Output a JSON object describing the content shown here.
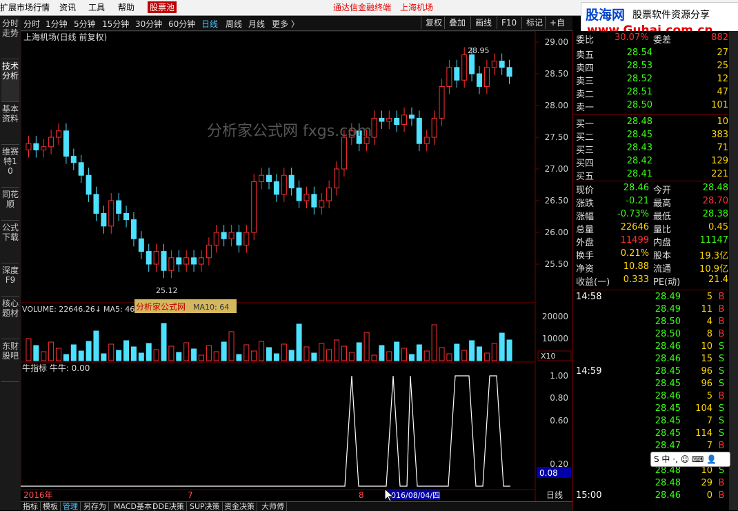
{
  "menu": {
    "items": [
      "扩展市场行情",
      "资讯",
      "工具",
      "帮助"
    ],
    "active": "股票池",
    "center_text": "通达信金融终端",
    "center_stock": "上海机场"
  },
  "left_tabs": [
    "分时走势",
    "技术分析",
    "基本资料",
    "维赛特10",
    "同花顺",
    "公式下载",
    "深度F9",
    "核心题材",
    "东财股吧"
  ],
  "period_bar": {
    "periods": [
      "分时",
      "1分钟",
      "5分钟",
      "15分钟",
      "30分钟",
      "60分钟",
      "日线",
      "周线",
      "月线",
      "更多 〉"
    ],
    "active": "日线",
    "right_buttons": [
      "复权",
      "叠加",
      "画线",
      "F10",
      "标记",
      "+自选"
    ]
  },
  "chart": {
    "title": "上海机场(日线 前复权)",
    "max_label": "28.95",
    "min_label": "25.12",
    "price_ticks": [
      "29.00",
      "28.50",
      "28.00",
      "27.50",
      "27.00",
      "26.50",
      "26.00",
      "25.50"
    ],
    "volume_label": "VOLUME: 22646.26↓",
    "ma5_label": "MA5: 46",
    "ma10_label": "MA10: 64",
    "vol_ticks": [
      "20000",
      "10000"
    ],
    "vol_unit": "X10",
    "indicator_label": "牛指标  牛牛: 0.00",
    "ind_ticks": [
      "1.00",
      "0.80",
      "0.60",
      "0.20"
    ],
    "ind_current": "0.08",
    "x_labels": [
      "2016年",
      "7",
      "8"
    ],
    "cursor_date": "2016/08/04/四",
    "period_label": "日线",
    "watermark": "分析家公式网 fxgs.com",
    "watermark_small": "分析家公式网"
  },
  "orderbook": {
    "top_partial": {
      "label": "委比",
      "value": "30.07%",
      "label2": "委差",
      "value2": "882"
    },
    "asks": [
      {
        "label": "卖五",
        "price": "28.54",
        "vol": "27"
      },
      {
        "label": "卖四",
        "price": "28.53",
        "vol": "25"
      },
      {
        "label": "卖三",
        "price": "28.52",
        "vol": "12"
      },
      {
        "label": "卖二",
        "price": "28.51",
        "vol": "47"
      },
      {
        "label": "卖一",
        "price": "28.50",
        "vol": "101"
      }
    ],
    "bids": [
      {
        "label": "买一",
        "price": "28.48",
        "vol": "10"
      },
      {
        "label": "买二",
        "price": "28.45",
        "vol": "383"
      },
      {
        "label": "买三",
        "price": "28.43",
        "vol": "71"
      },
      {
        "label": "买四",
        "price": "28.42",
        "vol": "129"
      },
      {
        "label": "买五",
        "price": "28.41",
        "vol": "221"
      }
    ]
  },
  "quote": [
    {
      "l1": "现价",
      "v1": "28.46",
      "c1": "green",
      "l2": "今开",
      "v2": "28.48",
      "c2": "green"
    },
    {
      "l1": "涨跌",
      "v1": "-0.21",
      "c1": "green",
      "l2": "最高",
      "v2": "28.70",
      "c2": "red"
    },
    {
      "l1": "涨幅",
      "v1": "-0.73%",
      "c1": "green",
      "l2": "最低",
      "v2": "28.38",
      "c2": "green"
    },
    {
      "l1": "总量",
      "v1": "22646",
      "c1": "yellow",
      "l2": "量比",
      "v2": "0.45",
      "c2": "yellow"
    },
    {
      "l1": "外盘",
      "v1": "11499",
      "c1": "red",
      "l2": "内盘",
      "v2": "11147",
      "c2": "green"
    },
    {
      "l1": "换手",
      "v1": "0.21%",
      "c1": "yellow",
      "l2": "股本",
      "v2": "19.3亿",
      "c2": "yellow"
    },
    {
      "l1": "净资",
      "v1": "10.88",
      "c1": "yellow",
      "l2": "流通",
      "v2": "10.9亿",
      "c2": "yellow"
    },
    {
      "l1": "收益(一)",
      "v1": "0.333",
      "c1": "yellow",
      "l2": "PE(动)",
      "v2": "21.4",
      "c2": "yellow"
    }
  ],
  "trades": [
    {
      "time": "14:58",
      "price": "28.49",
      "vol": "5",
      "side": "B"
    },
    {
      "time": "",
      "price": "28.49",
      "vol": "11",
      "side": "B"
    },
    {
      "time": "",
      "price": "28.50",
      "vol": "4",
      "side": "B"
    },
    {
      "time": "",
      "price": "28.50",
      "vol": "8",
      "side": "B"
    },
    {
      "time": "",
      "price": "28.46",
      "vol": "10",
      "side": "S"
    },
    {
      "time": "",
      "price": "28.46",
      "vol": "15",
      "side": "S"
    },
    {
      "time": "14:59",
      "price": "28.45",
      "vol": "96",
      "side": "S"
    },
    {
      "time": "",
      "price": "28.45",
      "vol": "96",
      "side": "S"
    },
    {
      "time": "",
      "price": "28.46",
      "vol": "5",
      "side": "B"
    },
    {
      "time": "",
      "price": "28.45",
      "vol": "104",
      "side": "S"
    },
    {
      "time": "",
      "price": "28.45",
      "vol": "7",
      "side": "S"
    },
    {
      "time": "",
      "price": "28.45",
      "vol": "114",
      "side": "S"
    },
    {
      "time": "",
      "price": "28.47",
      "vol": "7",
      "side": "B"
    },
    {
      "time": "",
      "price": "28.46",
      "vol": "",
      "side": "B"
    },
    {
      "time": "",
      "price": "28.48",
      "vol": "10",
      "side": "S"
    },
    {
      "time": "",
      "price": "28.48",
      "vol": "29",
      "side": "B"
    },
    {
      "time": "15:00",
      "price": "28.46",
      "vol": "0",
      "side": "B"
    }
  ],
  "bottom_tabs": [
    "指标",
    "模板",
    "管理",
    "另存为",
    "MACD基本",
    "DDE决策",
    "SUP决策",
    "资金决策",
    "大师傅"
  ],
  "logo": {
    "title": "股海网",
    "subtitle": "股票软件资源分享",
    "url": "www.Guhai.com.cn"
  },
  "ime": {
    "label": "S 中 ·, ☺ ⌨ 👤"
  },
  "colors": {
    "up": "#ff3030",
    "down": "#4ee1ff",
    "bg": "#000000",
    "accent": "#c00000"
  }
}
